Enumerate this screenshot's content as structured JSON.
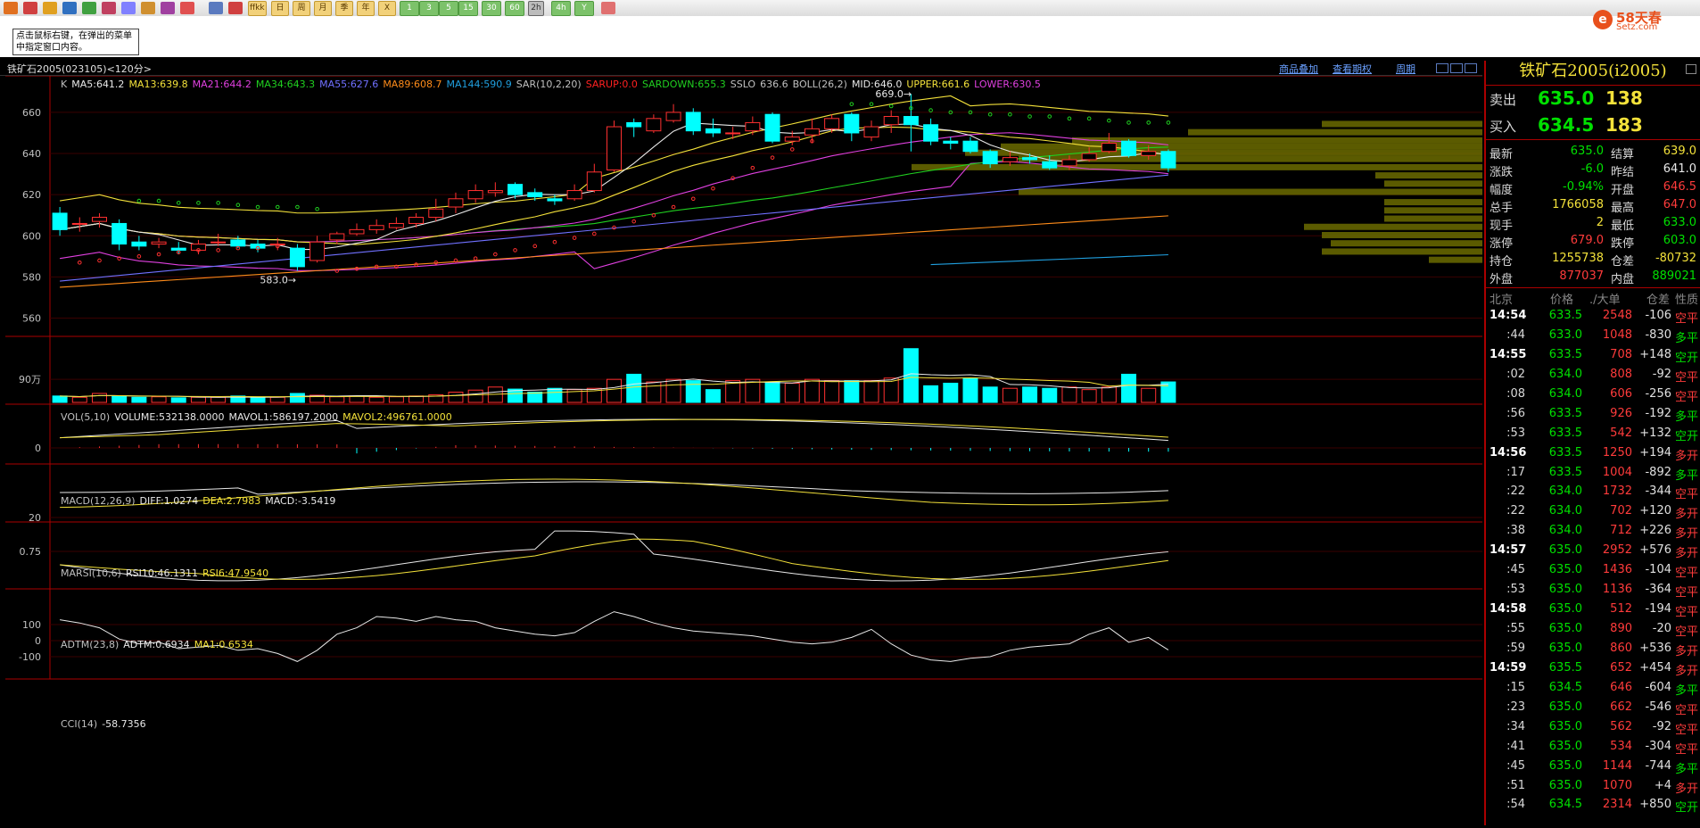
{
  "toolbar": {
    "buttons": [
      "1",
      "3",
      "5",
      "15",
      "30",
      "60",
      "2h",
      "4h"
    ],
    "cn_buttons": [
      "日",
      "周",
      "月",
      "季",
      "年"
    ],
    "selected": "2h",
    "extra_labels": [
      "ffkk",
      "X",
      "Y"
    ]
  },
  "hint": "点击鼠标右键，在弹出的菜单中指定窗口内容。",
  "logo": {
    "text": "58天春",
    "domain": "Setz.com"
  },
  "titlebar": {
    "symbol": "铁矿石2005(023105)<120分>",
    "links": [
      "商品叠加",
      "查看期权",
      "周期"
    ]
  },
  "main_legend": [
    {
      "text": "K",
      "color": "#c0c0c0"
    },
    {
      "text": "MA5:641.2",
      "color": "#e8e8e8"
    },
    {
      "text": "MA13:639.8",
      "color": "#f3e13a"
    },
    {
      "text": "MA21:644.2",
      "color": "#e040e0"
    },
    {
      "text": "MA34:643.3",
      "color": "#20d020"
    },
    {
      "text": "MA55:627.6",
      "color": "#7070ff"
    },
    {
      "text": "MA89:608.7",
      "color": "#ff8c1a"
    },
    {
      "text": "MA144:590.9",
      "color": "#20a0e0"
    },
    {
      "text": "SAR(10,2,20)",
      "color": "#c0c0c0"
    },
    {
      "text": "SARUP:0.0",
      "color": "#ff2020"
    },
    {
      "text": "SARDOWN:655.3",
      "color": "#20d020"
    },
    {
      "text": "SSLO",
      "color": "#c0c0c0"
    },
    {
      "text": "636.6",
      "color": "#c0c0c0"
    },
    {
      "text": "BOLL(26,2)",
      "color": "#c0c0c0"
    },
    {
      "text": "MID:646.0",
      "color": "#e8e8e8"
    },
    {
      "text": "UPPER:661.6",
      "color": "#f3e13a"
    },
    {
      "text": "LOWER:630.5",
      "color": "#e040e0"
    }
  ],
  "price_axis": [
    "660",
    "640",
    "620",
    "600",
    "580",
    "560"
  ],
  "annotations": {
    "high": "669.0",
    "low": "583.0"
  },
  "vol_legend": [
    {
      "text": "VOL(5,10)",
      "color": "#c0c0c0"
    },
    {
      "text": "VOLUME:532138.0000",
      "color": "#e8e8e8"
    },
    {
      "text": "MAVOL1:586197.2000",
      "color": "#e8e8e8"
    },
    {
      "text": "MAVOL2:496761.0000",
      "color": "#f3e13a"
    }
  ],
  "vol_axis": "90万",
  "macd_legend": [
    {
      "text": "MACD(12,26,9)",
      "color": "#c0c0c0"
    },
    {
      "text": "DIFF:1.0274",
      "color": "#e8e8e8"
    },
    {
      "text": "DEA:2.7983",
      "color": "#f3e13a"
    },
    {
      "text": "MACD:-3.5419",
      "color": "#e8e8e8"
    }
  ],
  "macd_axis": "0",
  "rsi_legend": [
    {
      "text": "MARSI(10,6)",
      "color": "#c0c0c0"
    },
    {
      "text": "RSI10:46.1311",
      "color": "#e8e8e8"
    },
    {
      "text": "RSI6:47.9540",
      "color": "#f3e13a"
    }
  ],
  "rsi_axis": "20",
  "adtm_legend": [
    {
      "text": "ADTM(23,8)",
      "color": "#c0c0c0"
    },
    {
      "text": "ADTM:0.6934",
      "color": "#e8e8e8"
    },
    {
      "text": "MA1:0.6534",
      "color": "#f3e13a"
    }
  ],
  "adtm_axis": "0.75",
  "cci_legend": [
    {
      "text": "CCI(14)",
      "color": "#c0c0c0"
    },
    {
      "text": "-58.7356",
      "color": "#e8e8e8"
    }
  ],
  "cci_axis": [
    "100",
    "0",
    "-100"
  ],
  "chart_data": {
    "type": "candlestick",
    "ylim": [
      552,
      676
    ],
    "candles": [
      [
        611,
        603,
        614,
        600
      ],
      [
        606,
        606,
        609,
        602
      ],
      [
        607,
        609,
        611,
        604
      ],
      [
        606,
        596,
        608,
        593
      ],
      [
        597,
        595,
        600,
        593
      ],
      [
        596,
        597,
        599,
        594
      ],
      [
        594,
        593,
        597,
        591
      ],
      [
        593,
        596,
        598,
        591
      ],
      [
        597,
        597,
        601,
        595
      ],
      [
        598,
        595,
        600,
        594
      ],
      [
        596,
        594,
        598,
        592
      ],
      [
        596,
        596,
        599,
        593
      ],
      [
        594,
        585,
        596,
        583
      ],
      [
        588,
        597,
        600,
        587
      ],
      [
        598,
        601,
        602,
        596
      ],
      [
        601,
        603,
        606,
        600
      ],
      [
        603,
        605,
        608,
        601
      ],
      [
        604,
        606,
        609,
        603
      ],
      [
        606,
        609,
        611,
        604
      ],
      [
        609,
        613,
        618,
        607
      ],
      [
        614,
        618,
        621,
        611
      ],
      [
        618,
        622,
        625,
        616
      ],
      [
        621,
        622,
        626,
        619
      ],
      [
        625,
        620,
        626,
        618
      ],
      [
        621,
        619,
        623,
        617
      ],
      [
        618,
        617,
        620,
        615
      ],
      [
        618,
        622,
        625,
        617
      ],
      [
        622,
        631,
        635,
        621
      ],
      [
        632,
        653,
        656,
        631
      ],
      [
        655,
        653,
        657,
        648
      ],
      [
        651,
        657,
        659,
        650
      ],
      [
        656,
        660,
        664,
        655
      ],
      [
        660,
        651,
        662,
        649
      ],
      [
        652,
        650,
        657,
        648
      ],
      [
        650,
        650,
        653,
        647
      ],
      [
        651,
        655,
        658,
        649
      ],
      [
        659,
        646,
        660,
        645
      ],
      [
        646,
        648,
        651,
        644
      ],
      [
        649,
        652,
        657,
        645
      ],
      [
        652,
        657,
        659,
        650
      ],
      [
        659,
        650,
        660,
        646
      ],
      [
        648,
        653,
        656,
        646
      ],
      [
        654,
        658,
        661,
        650
      ],
      [
        658,
        654,
        669,
        641
      ],
      [
        654,
        646,
        657,
        644
      ],
      [
        646,
        645,
        648,
        642
      ],
      [
        646,
        641,
        648,
        640
      ],
      [
        641,
        635,
        642,
        633
      ],
      [
        636,
        638,
        641,
        634
      ],
      [
        638,
        637,
        640,
        635
      ],
      [
        636,
        633,
        639,
        632
      ],
      [
        634,
        637,
        639,
        632
      ],
      [
        637,
        640,
        643,
        636
      ],
      [
        641,
        645,
        650,
        640
      ],
      [
        646,
        639,
        647,
        638
      ],
      [
        639,
        641,
        644,
        637
      ],
      [
        641,
        633,
        642,
        631
      ]
    ],
    "volume": [
      25,
      20,
      35,
      25,
      20,
      22,
      18,
      20,
      20,
      25,
      18,
      20,
      35,
      28,
      22,
      25,
      20,
      22,
      25,
      30,
      40,
      48,
      60,
      52,
      40,
      55,
      50,
      55,
      90,
      110,
      80,
      90,
      85,
      50,
      85,
      90,
      80,
      75,
      90,
      85,
      85,
      85,
      95,
      210,
      65,
      75,
      95,
      60,
      55,
      60,
      55,
      60,
      50,
      60,
      110,
      55,
      80
    ],
    "sar_up": [
      [
        1,
        587
      ],
      [
        2,
        588
      ],
      [
        3,
        589
      ],
      [
        4,
        590
      ],
      [
        5,
        591
      ],
      [
        6,
        592
      ],
      [
        7,
        593
      ],
      [
        8,
        593
      ],
      [
        9,
        594
      ],
      [
        10,
        594
      ],
      [
        11,
        595
      ],
      [
        14,
        583
      ],
      [
        15,
        584
      ],
      [
        16,
        585
      ],
      [
        17,
        585
      ],
      [
        18,
        586
      ],
      [
        19,
        587
      ],
      [
        20,
        588
      ],
      [
        21,
        589
      ],
      [
        22,
        591
      ],
      [
        23,
        593
      ],
      [
        24,
        595
      ],
      [
        25,
        597
      ],
      [
        26,
        599
      ],
      [
        27,
        601
      ],
      [
        28,
        604
      ],
      [
        29,
        607
      ],
      [
        30,
        610
      ],
      [
        31,
        614
      ],
      [
        32,
        618
      ],
      [
        33,
        623
      ],
      [
        34,
        628
      ],
      [
        35,
        633
      ],
      [
        36,
        638
      ],
      [
        37,
        642
      ],
      [
        38,
        646
      ]
    ],
    "sar_down": [
      [
        4,
        617
      ],
      [
        5,
        617
      ],
      [
        6,
        616
      ],
      [
        7,
        616
      ],
      [
        8,
        616
      ],
      [
        9,
        615
      ],
      [
        10,
        614
      ],
      [
        11,
        614
      ],
      [
        12,
        614
      ],
      [
        13,
        613
      ],
      [
        40,
        664
      ],
      [
        41,
        664
      ],
      [
        42,
        663
      ],
      [
        43,
        662
      ],
      [
        44,
        661
      ],
      [
        45,
        660
      ],
      [
        46,
        660
      ],
      [
        47,
        659
      ],
      [
        48,
        659
      ],
      [
        49,
        658
      ],
      [
        50,
        658
      ],
      [
        51,
        657
      ],
      [
        52,
        657
      ],
      [
        53,
        656
      ],
      [
        54,
        655
      ],
      [
        55,
        655
      ],
      [
        56,
        655
      ]
    ]
  },
  "quote": {
    "title": "铁矿石2005(i2005)",
    "ask_label": "卖出",
    "ask_price": "635.0",
    "ask_vol": "138",
    "bid_label": "买入",
    "bid_price": "634.5",
    "bid_vol": "183",
    "stats": [
      {
        "l1": "最新",
        "v1": "635.0",
        "c1": "green",
        "l2": "结算",
        "v2": "639.0",
        "c2": "yel"
      },
      {
        "l1": "涨跌",
        "v1": "-6.0",
        "c1": "green",
        "l2": "昨结",
        "v2": "641.0",
        "c2": "wht"
      },
      {
        "l1": "幅度",
        "v1": "-0.94%",
        "c1": "green",
        "l2": "开盘",
        "v2": "646.5",
        "c2": "red"
      },
      {
        "l1": "总手",
        "v1": "1766058",
        "c1": "yel",
        "l2": "最高",
        "v2": "647.0",
        "c2": "red"
      },
      {
        "l1": "现手",
        "v1": "2",
        "c1": "yel",
        "l2": "最低",
        "v2": "633.0",
        "c2": "green"
      },
      {
        "l1": "涨停",
        "v1": "679.0",
        "c1": "red",
        "l2": "跌停",
        "v2": "603.0",
        "c2": "green"
      },
      {
        "l1": "持仓",
        "v1": "1255738",
        "c1": "yel",
        "l2": "仓差",
        "v2": "-80732",
        "c2": "yel"
      },
      {
        "l1": "外盘",
        "v1": "877037",
        "c1": "red",
        "l2": "内盘",
        "v2": "889021",
        "c2": "green"
      }
    ],
    "tick_headers": [
      "北京",
      "价格",
      "./大单",
      "仓差",
      "性质"
    ],
    "ticks": [
      {
        "t": "14:54",
        "full": true,
        "p": "633.5",
        "v": "2548",
        "d": "-106",
        "n": "空平",
        "nc": "red"
      },
      {
        "t": ":44",
        "p": "633.0",
        "v": "1048",
        "d": "-830",
        "n": "多平",
        "nc": "green"
      },
      {
        "t": "14:55",
        "full": true,
        "p": "633.5",
        "v": "708",
        "d": "+148",
        "n": "空开",
        "nc": "green"
      },
      {
        "t": ":02",
        "p": "634.0",
        "v": "808",
        "d": "-92",
        "n": "空平",
        "nc": "red"
      },
      {
        "t": ":08",
        "p": "634.0",
        "v": "606",
        "d": "-256",
        "n": "空平",
        "nc": "red"
      },
      {
        "t": ":56",
        "p": "633.5",
        "v": "926",
        "d": "-192",
        "n": "多平",
        "nc": "green"
      },
      {
        "t": ":53",
        "p": "633.5",
        "v": "542",
        "d": "+132",
        "n": "空开",
        "nc": "green"
      },
      {
        "t": "14:56",
        "full": true,
        "p": "633.5",
        "v": "1250",
        "d": "+194",
        "n": "多开",
        "nc": "red"
      },
      {
        "t": ":17",
        "p": "633.5",
        "v": "1004",
        "d": "-892",
        "n": "多平",
        "nc": "green"
      },
      {
        "t": ":22",
        "p": "634.0",
        "v": "1732",
        "d": "-344",
        "n": "空平",
        "nc": "red"
      },
      {
        "t": ":22",
        "p": "634.0",
        "v": "702",
        "d": "+120",
        "n": "多开",
        "nc": "red"
      },
      {
        "t": ":38",
        "p": "634.0",
        "v": "712",
        "d": "+226",
        "n": "多开",
        "nc": "red"
      },
      {
        "t": "14:57",
        "full": true,
        "p": "635.0",
        "v": "2952",
        "d": "+576",
        "n": "多开",
        "nc": "red"
      },
      {
        "t": ":45",
        "p": "635.0",
        "v": "1436",
        "d": "-104",
        "n": "空平",
        "nc": "red"
      },
      {
        "t": ":53",
        "p": "635.0",
        "v": "1136",
        "d": "-364",
        "n": "空平",
        "nc": "red"
      },
      {
        "t": "14:58",
        "full": true,
        "p": "635.0",
        "v": "512",
        "d": "-194",
        "n": "空平",
        "nc": "red"
      },
      {
        "t": ":55",
        "p": "635.0",
        "v": "890",
        "d": "-20",
        "n": "空平",
        "nc": "red"
      },
      {
        "t": ":59",
        "p": "635.0",
        "v": "860",
        "d": "+536",
        "n": "多开",
        "nc": "red"
      },
      {
        "t": "14:59",
        "full": true,
        "p": "635.5",
        "v": "652",
        "d": "+454",
        "n": "多开",
        "nc": "red"
      },
      {
        "t": ":15",
        "p": "634.5",
        "v": "646",
        "d": "-604",
        "n": "多平",
        "nc": "green"
      },
      {
        "t": ":23",
        "p": "635.0",
        "v": "662",
        "d": "-546",
        "n": "空平",
        "nc": "red"
      },
      {
        "t": ":34",
        "p": "635.0",
        "v": "562",
        "d": "-92",
        "n": "空平",
        "nc": "red"
      },
      {
        "t": ":41",
        "p": "635.0",
        "v": "534",
        "d": "-304",
        "n": "空平",
        "nc": "red"
      },
      {
        "t": ":45",
        "p": "635.0",
        "v": "1144",
        "d": "-744",
        "n": "多平",
        "nc": "green"
      },
      {
        "t": ":51",
        "p": "635.0",
        "v": "1070",
        "d": "+4",
        "n": "多开",
        "nc": "red"
      },
      {
        "t": ":54",
        "p": "634.5",
        "v": "2314",
        "d": "+850",
        "n": "空开",
        "nc": "green"
      }
    ]
  }
}
